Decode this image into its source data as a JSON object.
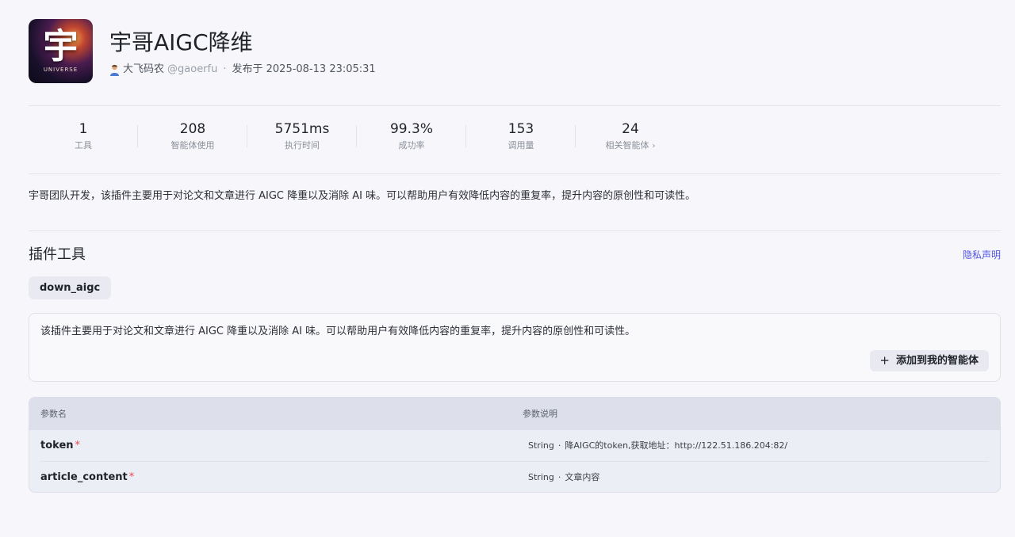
{
  "header": {
    "logo_char": "宇",
    "logo_sub": "UNIVERSE",
    "title": "宇哥AIGC降维",
    "author_name": "大飞码农",
    "author_handle": "@gaoerfu",
    "separator": "·",
    "publish_text": "发布于 2025-08-13 23:05:31"
  },
  "stats": [
    {
      "value": "1",
      "label": "工具"
    },
    {
      "value": "208",
      "label": "智能体使用"
    },
    {
      "value": "5751ms",
      "label": "执行时间"
    },
    {
      "value": "99.3%",
      "label": "成功率"
    },
    {
      "value": "153",
      "label": "调用量"
    },
    {
      "value": "24",
      "label": "相关智能体"
    }
  ],
  "description": "宇哥团队开发，该插件主要用于对论文和文章进行 AIGC 降重以及消除 AI 味。可以帮助用户有效降低内容的重复率，提升内容的原创性和可读性。",
  "tools_section": {
    "title": "插件工具",
    "privacy_link": "隐私声明",
    "active_tab": "down_aigc",
    "tool_description": "该插件主要用于对论文和文章进行 AIGC 降重以及消除 AI 味。可以帮助用户有效降低内容的重复率，提升内容的原创性和可读性。",
    "add_button": "添加到我的智能体"
  },
  "params_table": {
    "headers": [
      "参数名",
      "参数说明"
    ],
    "rows": [
      {
        "name": "token",
        "required": "*",
        "type": "String",
        "bullet": "·",
        "desc": "降AIGC的token,获取地址：http://122.51.186.204:82/"
      },
      {
        "name": "article_content",
        "required": "*",
        "type": "String",
        "bullet": "·",
        "desc": "文章内容"
      }
    ]
  },
  "colors": {
    "accent_link": "#4d53e8",
    "required_mark": "#e5484d",
    "page_bg": "#f7f7fb"
  }
}
